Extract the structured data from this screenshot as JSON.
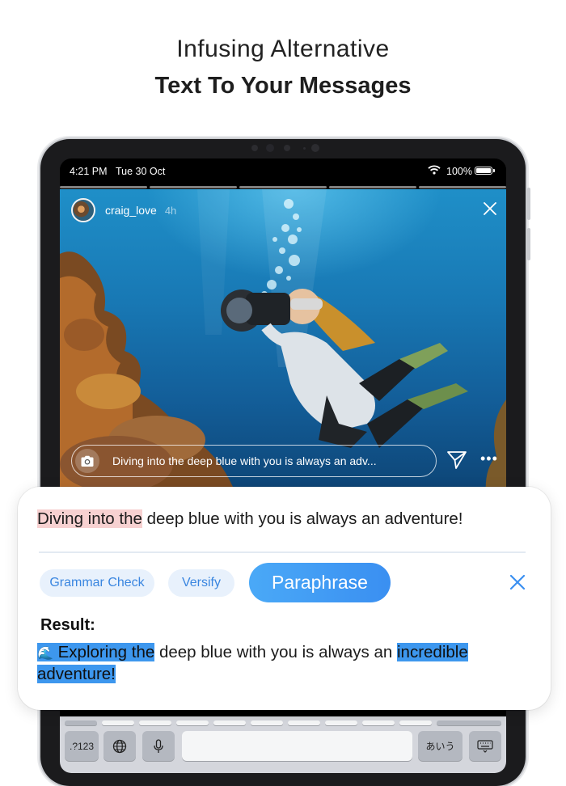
{
  "headline": {
    "line1": "Infusing Alternative",
    "line2": "Text To Your Messages"
  },
  "status_bar": {
    "time": "4:21 PM",
    "date": "Tue 30 Oct",
    "battery": "100%",
    "battery_level": 1.0
  },
  "story": {
    "username": "craig_love",
    "age": "4h",
    "reply_text": "Diving into the deep blue with you is always an adv..."
  },
  "keyboard": {
    "numbers_key": ".?123",
    "kana_key": "あいう"
  },
  "card": {
    "original_highlight": "Diving into the",
    "original_rest": " deep blue with you is always an adventure!",
    "chips": {
      "grammar": "Grammar Check",
      "versify": "Versify",
      "paraphrase": "Paraphrase"
    },
    "result_label": "Result:",
    "result": {
      "emoji": "🌊",
      "part1": " Exploring the",
      "part2": " deep blue with you is always an ",
      "part3": "incredible adventure!"
    }
  },
  "colors": {
    "accent": "#3a8ff1",
    "chip_bg": "#e8f1fc",
    "highlight_red": "#f7d1d1",
    "highlight_blue": "#3d97ee"
  }
}
